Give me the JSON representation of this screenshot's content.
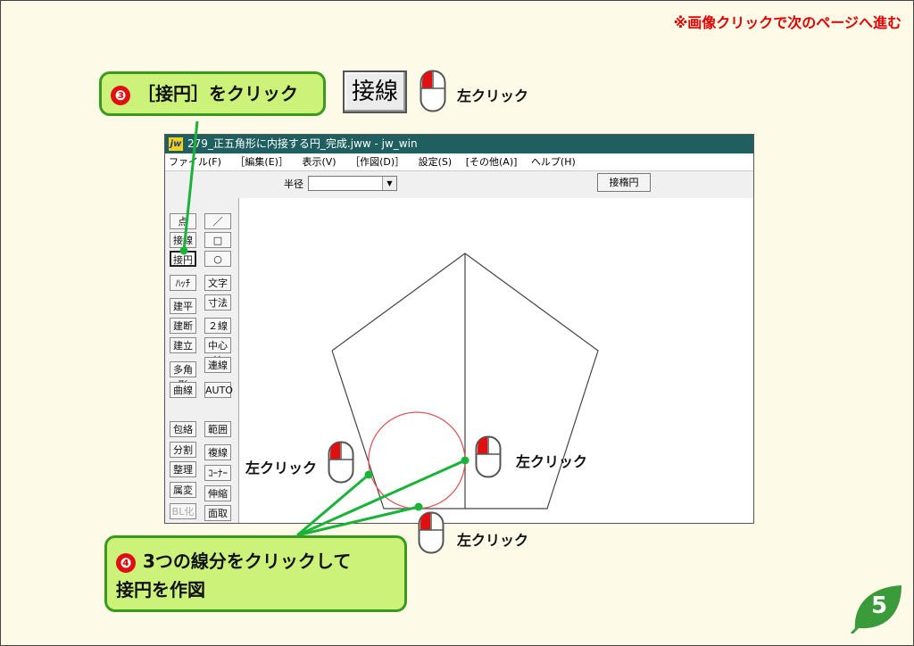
{
  "note": "※画像クリックで次のページへ進む",
  "step3": {
    "num": "❸",
    "text": "［接円］をクリック"
  },
  "big_button": {
    "label": "接線"
  },
  "click_label": "左クリック",
  "step4": {
    "num": "❹",
    "line1": "3つの線分をクリックして",
    "line2": "接円を作図"
  },
  "page_number": "5",
  "window": {
    "logo": "jw",
    "title": "279_正五角形に内接する円_完成.jww - jw_win",
    "menu": [
      "ファイル(F)",
      "［編集(E)］",
      "表示(V)",
      "［作図(D)］",
      "設定(S)",
      "[その他(A)]",
      "ヘルプ(H)"
    ],
    "toolbar": {
      "radius_label": "半径",
      "radius_value": "",
      "ellipse_button": "接楕円"
    },
    "tools_left": [
      "点",
      "接線",
      "接円",
      "ﾊｯﾁ",
      "建平",
      "建断",
      "建立",
      "多角形",
      "曲線",
      "包絡",
      "分割",
      "整理",
      "属変",
      "BL化"
    ],
    "tools_right": [
      "／",
      "□",
      "○",
      "文字",
      "寸法",
      "２線",
      "中心線",
      "連線",
      "AUTO",
      "範囲",
      "複線",
      "ｺｰﾅｰ",
      "伸縮",
      "面取"
    ]
  },
  "colors": {
    "callout_bg": "#ccf27a",
    "callout_border": "#3b9a1e",
    "accent_red": "#e00000",
    "titlebar": "#1f5f5f"
  }
}
